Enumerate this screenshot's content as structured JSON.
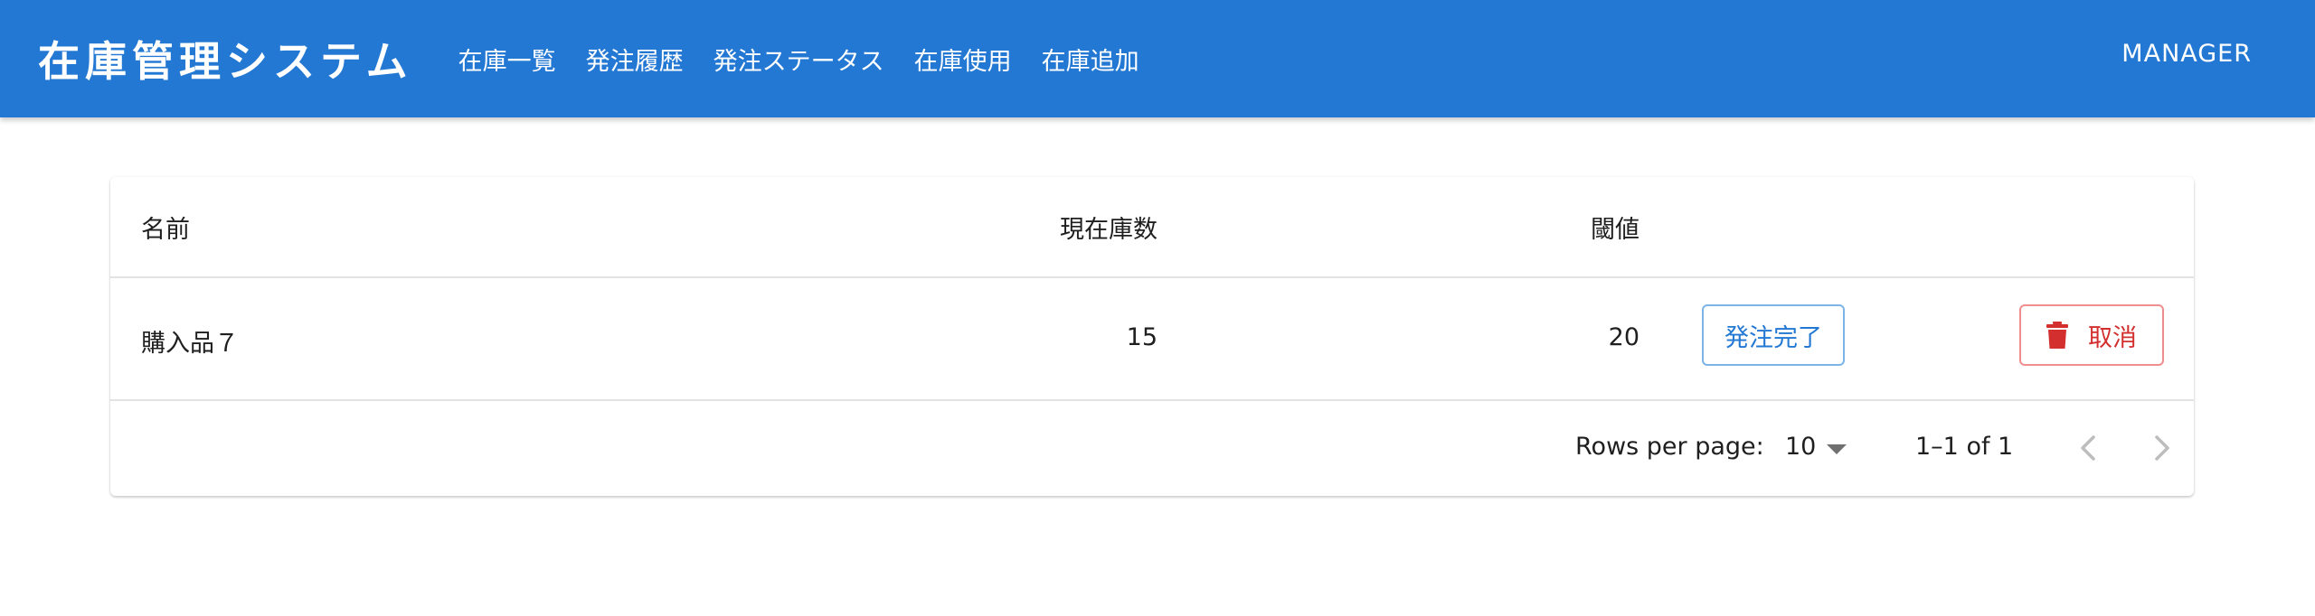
{
  "app": {
    "title": "在庫管理システム",
    "user": "MANAGER",
    "brand_color": "#2378d3"
  },
  "nav": {
    "items": [
      "在庫一覧",
      "発注履歴",
      "発注ステータス",
      "在庫使用",
      "在庫追加"
    ]
  },
  "table": {
    "headers": {
      "name": "名前",
      "stock": "現在庫数",
      "threshold": "閾値"
    },
    "rows": [
      {
        "name": "購入品７",
        "stock": "15",
        "threshold": "20",
        "complete_label": "発注完了",
        "cancel_label": "取消"
      }
    ]
  },
  "pagination": {
    "rows_per_page_label": "Rows per page:",
    "rows_per_page": "10",
    "range": "1–1 of 1"
  },
  "icons": {
    "delete": "trash-icon",
    "rows_per_page_dropdown": "caret-down-icon",
    "prev": "chevron-left-icon",
    "next": "chevron-right-icon"
  }
}
